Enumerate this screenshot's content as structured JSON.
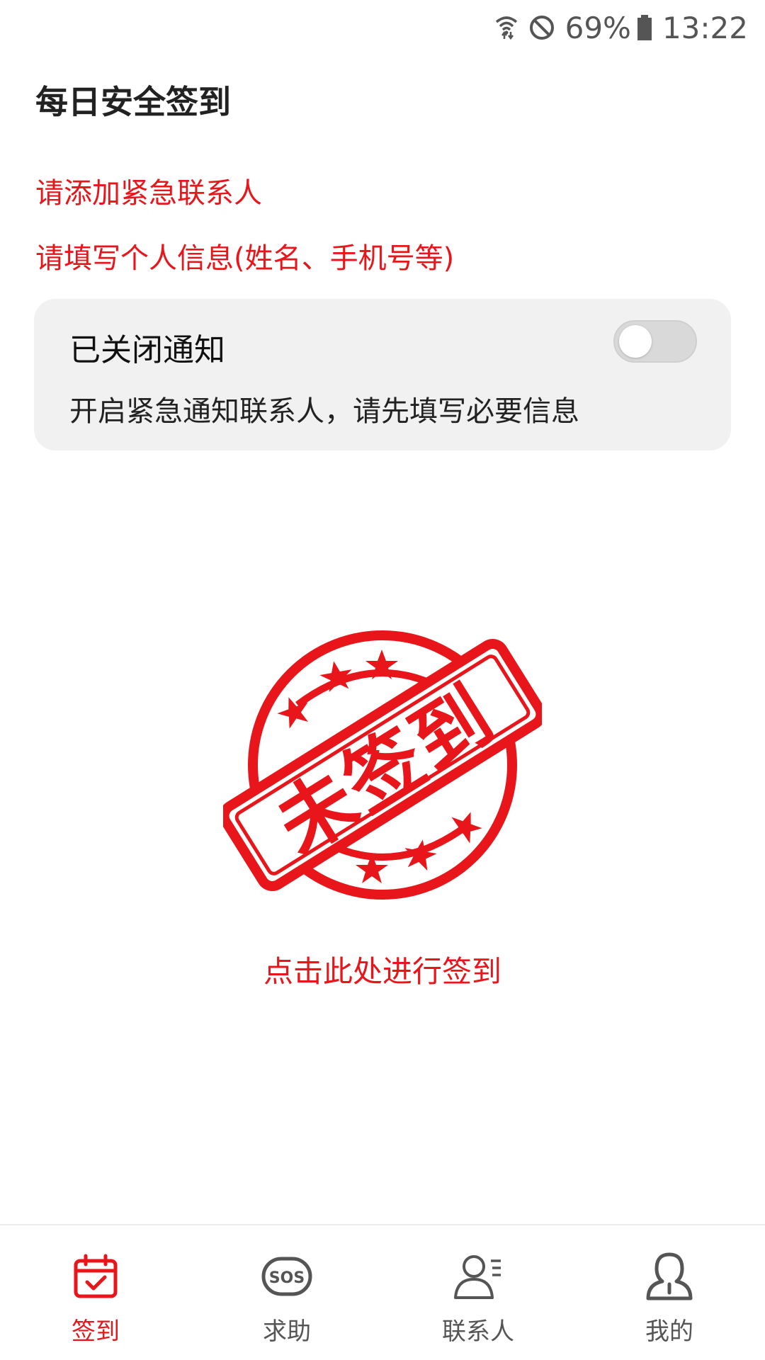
{
  "status_bar": {
    "battery": "69%",
    "time": "13:22",
    "icons": [
      "wifi-icon",
      "do-not-disturb-icon",
      "battery-icon"
    ]
  },
  "header": {
    "title": "每日安全签到"
  },
  "warnings": {
    "add_contact": "请添加紧急联系人",
    "fill_info": "请填写个人信息(姓名、手机号等)"
  },
  "notice_card": {
    "title": "已关闭通知",
    "description": "开启紧急通知联系人，请先填写必要信息",
    "toggle_on": false
  },
  "stamp": {
    "text": "未签到",
    "icon": "stamp-icon"
  },
  "checkin": {
    "label": "点击此处进行签到"
  },
  "bottom_nav": {
    "items": [
      {
        "label": "签到",
        "icon": "calendar-check-icon",
        "active": true
      },
      {
        "label": "求助",
        "icon": "sos-icon",
        "active": false
      },
      {
        "label": "联系人",
        "icon": "contacts-icon",
        "active": false
      },
      {
        "label": "我的",
        "icon": "profile-icon",
        "active": false
      }
    ]
  },
  "colors": {
    "accent": "#e8161b",
    "card_bg": "#f1f1f1",
    "text_dark": "#222222",
    "nav_inactive": "#555555"
  }
}
